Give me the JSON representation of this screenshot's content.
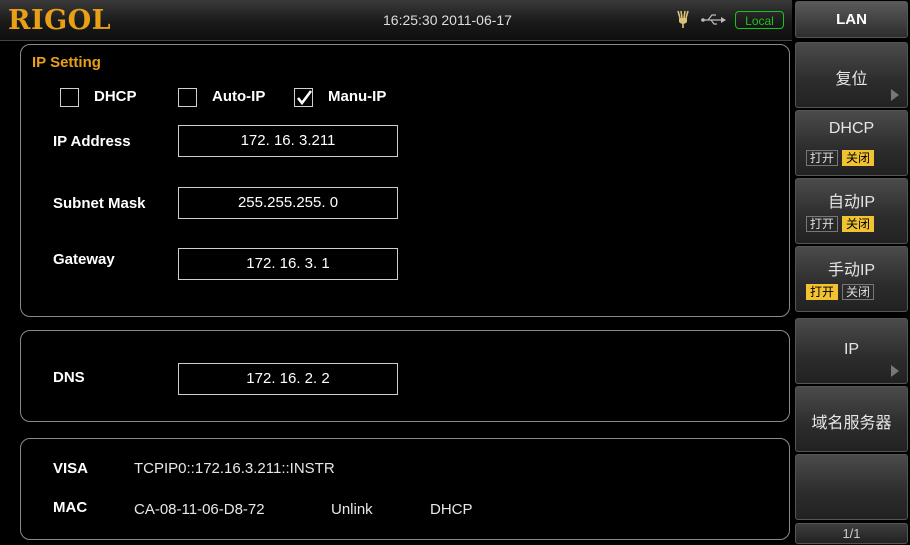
{
  "header": {
    "brand": "RIGOL",
    "datetime": "16:25:30 2011-06-17",
    "status_badge": "Local"
  },
  "ip_setting": {
    "title": "IP Setting",
    "modes": [
      {
        "label": "DHCP",
        "checked": false
      },
      {
        "label": "Auto-IP",
        "checked": false
      },
      {
        "label": "Manu-IP",
        "checked": true
      }
    ],
    "ip_address": {
      "label": "IP Address",
      "value": "172. 16.  3.211"
    },
    "subnet_mask": {
      "label": "Subnet Mask",
      "value": "255.255.255.  0"
    },
    "gateway": {
      "label": "Gateway",
      "value": "172. 16.  3.  1"
    }
  },
  "dns": {
    "label": "DNS",
    "value": "172. 16.  2.  2"
  },
  "info": {
    "visa_label": "VISA",
    "visa_value": "TCPIP0::172.16.3.211::INSTR",
    "mac_label": "MAC",
    "mac_value": "CA-08-11-06-D8-72",
    "link_status": "Unlink",
    "mode": "DHCP"
  },
  "sidebar": {
    "title": "LAN",
    "reset": "复位",
    "dhcp": {
      "label": "DHCP",
      "on": "打开",
      "off": "关闭",
      "selected": "off"
    },
    "auto_ip": {
      "label": "自动IP",
      "on": "打开",
      "off": "关闭",
      "selected": "off"
    },
    "manual_ip": {
      "label": "手动IP",
      "on": "打开",
      "off": "关闭",
      "selected": "on"
    },
    "ip": "IP",
    "dns_server": "域名服务器",
    "page": "1/1"
  },
  "colors": {
    "accent": "#e8a017",
    "local": "#1ec21e",
    "selected_option": "#f1c232"
  }
}
